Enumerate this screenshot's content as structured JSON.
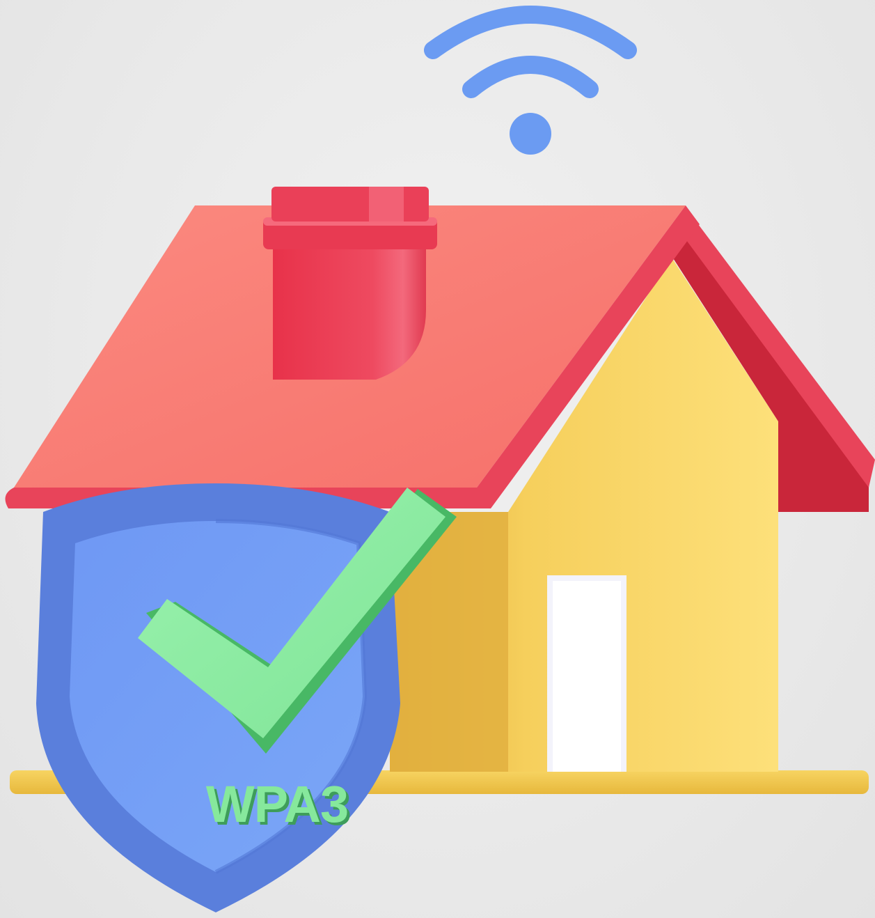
{
  "badge": {
    "label": "WPA3"
  },
  "colors": {
    "background": "#ebebeb",
    "wifi": "#6b9bf2",
    "roof": "#f97a72",
    "roof_edge": "#e8445a",
    "roof_side": "#c9263a",
    "chimney": "#e83a52",
    "house_wall": "#fbd968",
    "house_wall_shade": "#e6b73f",
    "door": "#ffffff",
    "ground": "#f2c94c",
    "shield_outer": "#5f82e0",
    "shield_inner": "#6f9df6",
    "check": "#8eeba3",
    "check_shade": "#4cc26a",
    "label_text": "#86e89c"
  },
  "icons": [
    "wifi-icon",
    "house-icon",
    "shield-icon",
    "checkmark-icon"
  ]
}
